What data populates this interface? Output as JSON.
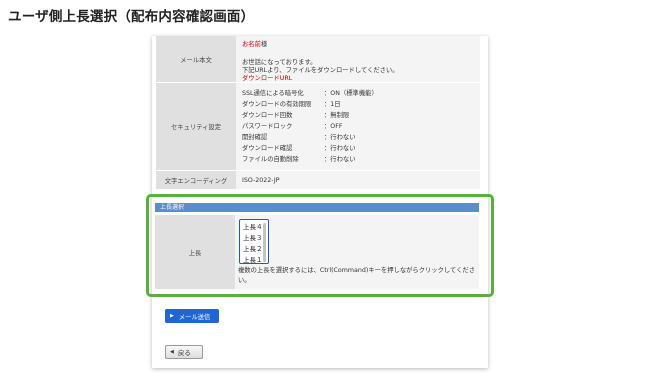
{
  "page_title": "ユーザ側上長選択（配布内容確認画面）",
  "mail_body": {
    "label": "メール本文",
    "recipient_name": "お名前",
    "honorific": "様",
    "line1": "お世話になっております。",
    "line2": "下記URLより、ファイルをダウンロードしてください。",
    "download_url": "ダウンロードURL"
  },
  "security": {
    "label": "セキュリティ設定",
    "settings": [
      {
        "key": "SSL通信による暗号化",
        "value": "：ON（標準機能）"
      },
      {
        "key": "ダウンロードの有効期限",
        "value": "：1日"
      },
      {
        "key": "ダウンロード回数",
        "value": "：無制限"
      },
      {
        "key": "パスワードロック",
        "value": "：OFF"
      },
      {
        "key": "開封確認",
        "value": "：行わない"
      },
      {
        "key": "ダウンロード確認",
        "value": "：行わない"
      },
      {
        "key": "ファイルの自動削除",
        "value": "：行わない"
      }
    ]
  },
  "encoding": {
    "label": "文字エンコーディング",
    "value": "ISO-2022-JP"
  },
  "supervisor_selection": {
    "header": "上長選択",
    "label": "上長",
    "options": [
      "上長４",
      "上長３",
      "上長２",
      "上長１"
    ],
    "help_text": "複数の上長を選択するには、Ctrl(Command)キーを押しながらクリックしてください。"
  },
  "buttons": {
    "send": "メール送信",
    "back": "戻る"
  },
  "colors": {
    "highlight_border": "#59b03e",
    "section_header": "#5b8bd0",
    "primary_button": "#1f66d4",
    "url_red": "#cc0000"
  }
}
